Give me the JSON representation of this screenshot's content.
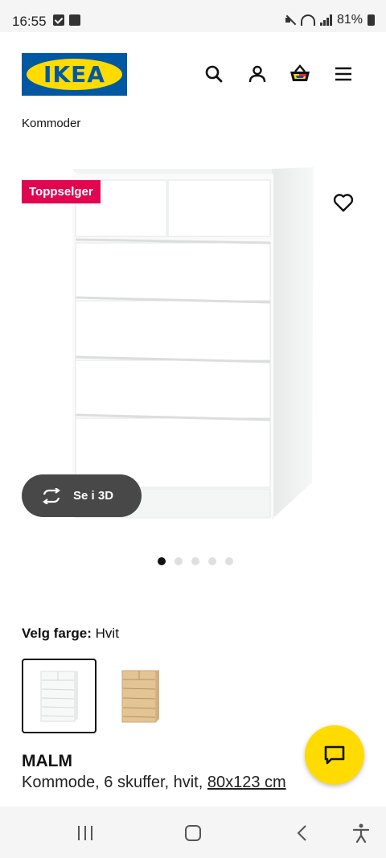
{
  "status_bar": {
    "time": "16:55",
    "battery": "81%",
    "icons": [
      "checkbox-notification-icon",
      "gallery-notification-icon",
      "mute-icon",
      "wifi-icon",
      "signal-icon",
      "battery-icon"
    ]
  },
  "header": {
    "logo_text": "IKEA",
    "brand_colors": {
      "blue": "#0058a3",
      "yellow": "#ffdb00"
    },
    "icons": [
      "search-icon",
      "account-icon",
      "basket-icon",
      "menu-icon"
    ]
  },
  "breadcrumb": "Kommoder",
  "gallery": {
    "badge": "Toppselger",
    "badge_color": "#e00751",
    "view_3d_label": "Se i 3D",
    "dot_count": 5,
    "active_dot": 0
  },
  "color_picker": {
    "label": "Velg farge:",
    "selected": "Hvit",
    "options": [
      "Hvit",
      "Eikefinér"
    ]
  },
  "product": {
    "name": "MALM",
    "description": "Kommode, 6 skuffer, hvit,",
    "size": "80x123 cm"
  },
  "nav_bar": {
    "icons": [
      "recent-apps-icon",
      "home-icon",
      "back-icon",
      "accessibility-icon"
    ]
  }
}
